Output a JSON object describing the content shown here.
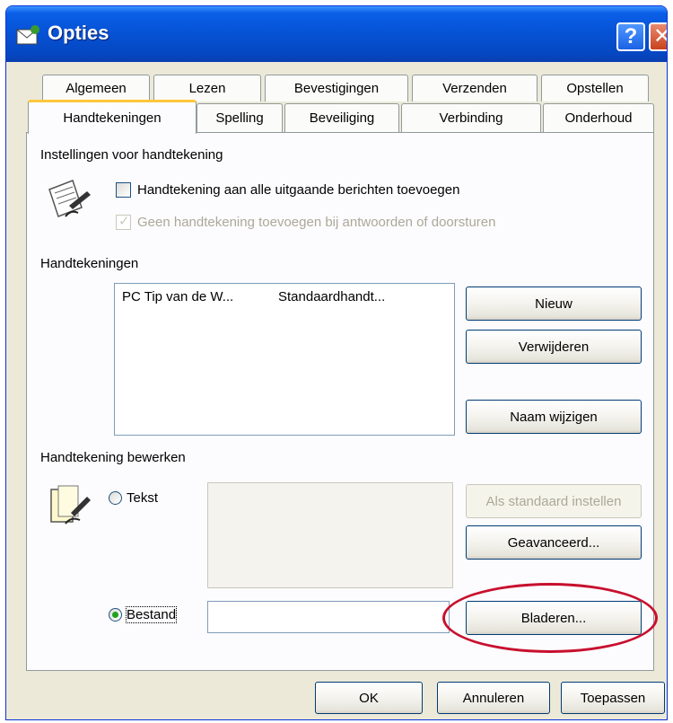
{
  "window": {
    "title": "Opties",
    "help_glyph": "?",
    "close_glyph": "✕"
  },
  "tabs": {
    "back_row": [
      "Algemeen",
      "Lezen",
      "Bevestigingen",
      "Verzenden",
      "Opstellen"
    ],
    "front_row": [
      "Handtekeningen",
      "Spelling",
      "Beveiliging",
      "Verbinding",
      "Onderhoud"
    ],
    "active": "Handtekeningen"
  },
  "settings_group": {
    "label": "Instellingen voor handtekening",
    "add_to_all": "Handtekening aan alle uitgaande berichten toevoegen",
    "no_reply": "Geen handtekening toevoegen bij antwoorden of doorsturen"
  },
  "signatures_group": {
    "label": "Handtekeningen",
    "list": [
      {
        "name": "PC Tip van de W...",
        "type": "Standaardhandt..."
      }
    ],
    "new_button": "Nieuw",
    "delete_button": "Verwijderen",
    "rename_button": "Naam wijzigen"
  },
  "edit_group": {
    "label": "Handtekening bewerken",
    "text_option": "Tekst",
    "file_option": "Bestand",
    "file_value": "",
    "set_default_button": "Als standaard instellen",
    "advanced_button": "Geavanceerd...",
    "browse_button": "Bladeren..."
  },
  "footer": {
    "ok_button": "OK",
    "cancel_button": "Annuleren",
    "apply_button": "Toepassen"
  },
  "colors": {
    "titlebar": "#0653d6",
    "highlight_circle": "#c8102e",
    "active_tab": "#ffc73c"
  }
}
